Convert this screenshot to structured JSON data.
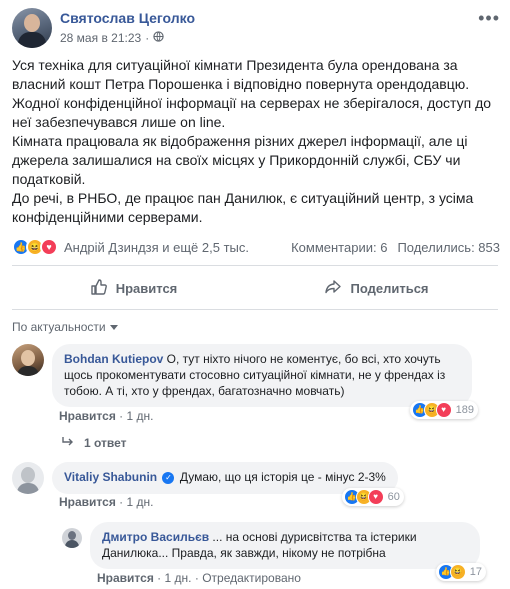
{
  "post": {
    "author": "Святослав Цеголко",
    "date": "28 мая в 21:23",
    "separator": "·",
    "paragraphs": [
      "Уся техніка для ситуаційної кімнати Президента була орендована за власний кошт Петра Порошенка і відповідно повернута орендодавцю. Жодної конфіденційної інформації на серверах не зберігалося, доступ до неї забезпечувався лише on line.",
      "Кімната працювала як відображення різних джерел інформації, але ці джерела залишалися на своїх місцях у Прикордонній службі, СБУ чи податковій.",
      "До речі, в РНБО, де працює пан Данилюк, є ситуаційний центр, з усіма конфіденційними серверами."
    ]
  },
  "stats": {
    "reactors": "Андрій Дзиндзя и ещё 2,5 тыс.",
    "comments": "Комментарии: 6",
    "shares": "Поделились: 853"
  },
  "actions": {
    "like": "Нравится",
    "share": "Поделиться"
  },
  "sort_label": "По актуальности",
  "comments": [
    {
      "name": "Bohdan Kutiepov",
      "text": "О, тут ніхто нічого не коментує, бо всі, хто хочуть щось прокоментувати стосовно ситуаційної кімнати, не у френдах із тобою. А ті, хто у френдах, багатозначно мовчать)",
      "reactions": "189",
      "like": "Нравится",
      "time": "1 дн."
    },
    {
      "name": "Vitaliy Shabunin",
      "text": "Думаю, що ця історія це - мінус 2-3%",
      "reactions": "60",
      "like": "Нравится",
      "time": "1 дн."
    },
    {
      "name": "Дмитро Васильєв",
      "text": "... на основі дурисвітства та істерики Данилюка... Правда, як завжди, нікому не потрібна",
      "reactions": "17",
      "like": "Нравится",
      "time": "1 дн.",
      "edited": "Отредактировано"
    }
  ],
  "replies_link": "1 ответ",
  "dot": "·",
  "colors": {
    "link": "#385898",
    "like": "#1877f2",
    "haha": "#f7b125",
    "love": "#f33e58"
  }
}
